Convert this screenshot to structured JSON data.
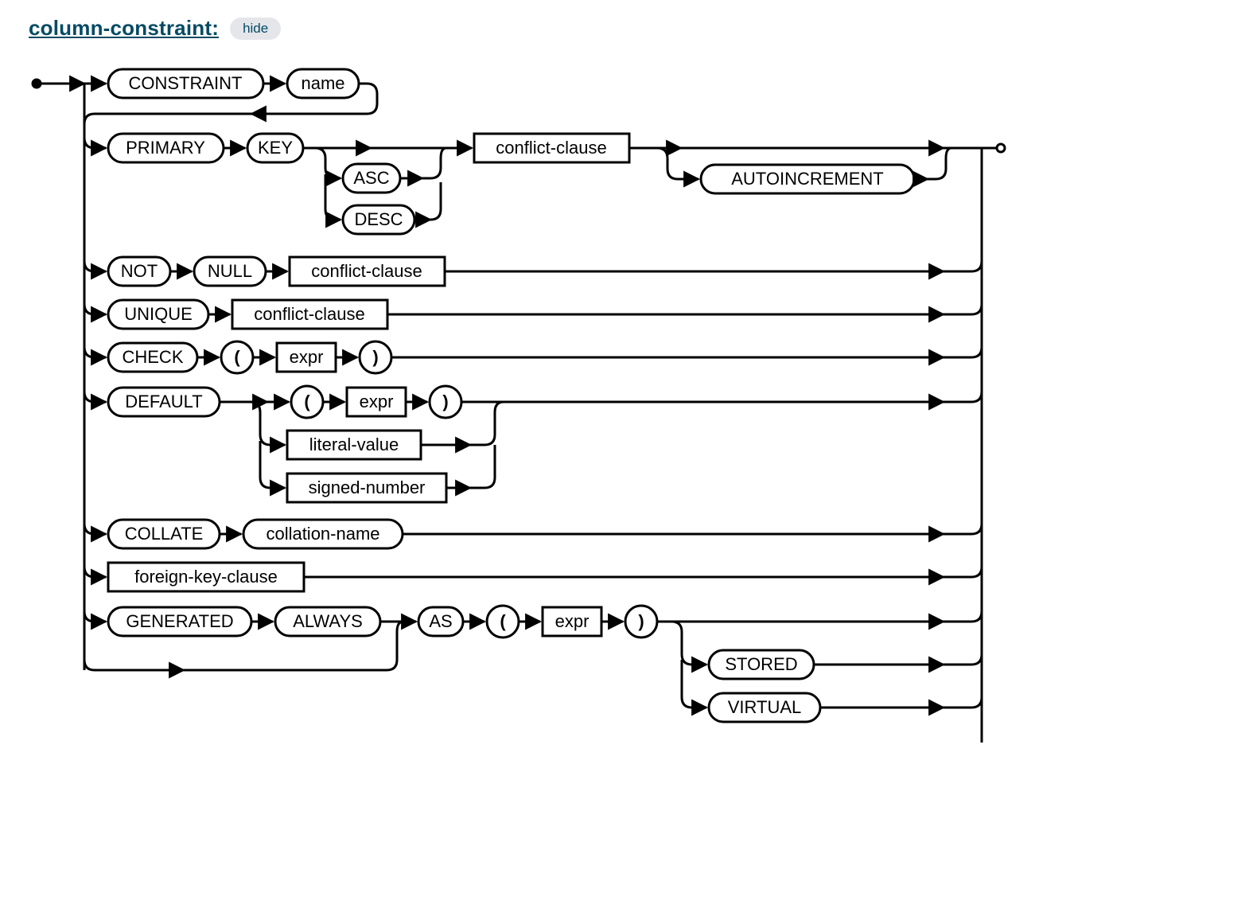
{
  "title": "column-constraint:",
  "hide": "hide",
  "constraint": "CONSTRAINT",
  "name": "name",
  "primary": "PRIMARY",
  "key": "KEY",
  "asc": "ASC",
  "desc": "DESC",
  "conflict1": "conflict-clause",
  "autoinc": "AUTOINCREMENT",
  "not": "NOT",
  "null": "NULL",
  "conflict2": "conflict-clause",
  "unique": "UNIQUE",
  "conflict3": "conflict-clause",
  "check": "CHECK",
  "lp1": "(",
  "expr1": "expr",
  "rp1": ")",
  "default": "DEFAULT",
  "lp2": "(",
  "expr2": "expr",
  "rp2": ")",
  "litval": "literal-value",
  "signednum": "signed-number",
  "collate": "COLLATE",
  "collname": "collation-name",
  "fkc": "foreign-key-clause",
  "generated": "GENERATED",
  "always": "ALWAYS",
  "as": "AS",
  "lp3": "(",
  "expr3": "expr",
  "rp3": ")",
  "stored": "STORED",
  "virtual": "VIRTUAL"
}
